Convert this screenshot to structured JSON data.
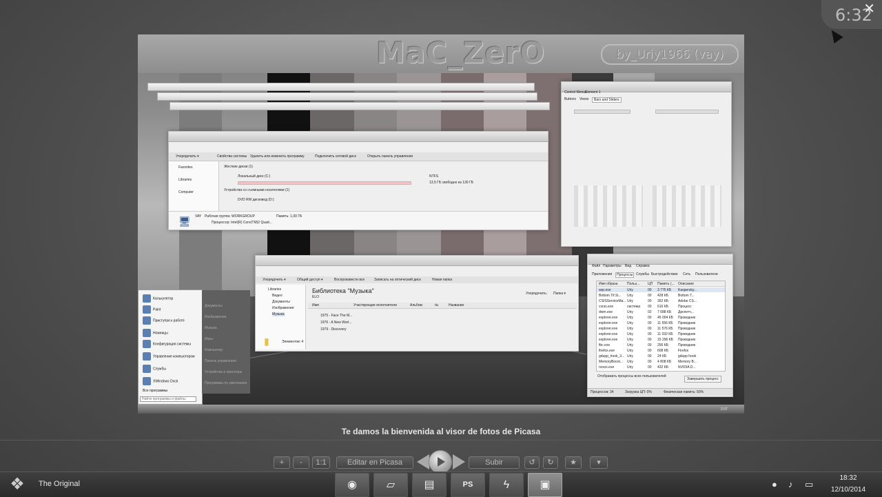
{
  "clock": {
    "time": "6:32"
  },
  "photo": {
    "banner_title": "MaC_ZerO",
    "banner_by": "by_Uriy1966  (vay)",
    "explorer": {
      "toolbar": [
        "Упорядочить ▾",
        "Свойства системы",
        "Удалить или изменить программу",
        "Подключить сетевой диск",
        "Открыть панель управления"
      ],
      "sidebar": [
        "Favorites",
        "Libraries",
        "Computer"
      ],
      "group_hdd": "Жесткие диски (1)",
      "drive_c": "Локальный диск (C:)",
      "drive_c_fs": "NTFS",
      "drive_c_free": "13,5 ГБ свободно из 130 ГБ",
      "group_removable": "Устройства со съемными носителями (1)",
      "drive_dvd": "DVD RW дисковод (D:)",
      "pc_name": "VAY",
      "workgroup": "Рабочая группа: WORKGROUP",
      "memory": "Память: 1,00 ГБ",
      "cpu": "Процессор: Intel(R) Core(TM)2 Quad..."
    },
    "music": {
      "toolbar": [
        "Упорядочить ▾",
        "Общий доступ ▾",
        "Воспроизвести все",
        "Записать на оптический диск",
        "Новая папка"
      ],
      "sidebar": [
        "Libraries",
        "Видео",
        "Документы",
        "Изображения",
        "Музыка"
      ],
      "title": "Библиотека \"Музыка\"",
      "subtitle": "ELO",
      "arrange": "Упорядочить:",
      "arrange_value": "Папка ▾",
      "columns": [
        "Имя",
        "Участвующие исполнители",
        "Альбом",
        "№",
        "Название"
      ],
      "items": [
        "1975 - Face The M...",
        "1976 - A New Worl...",
        "1979 - Discovery"
      ],
      "status": "Элементов: 4"
    },
    "control": {
      "menu": [
        "Control Menus",
        "Element 1"
      ],
      "tabs": [
        "Buttons",
        "Views",
        "Bars and Sliders"
      ]
    },
    "taskmgr": {
      "menu": [
        "Файл",
        "Параметры",
        "Вид",
        "Справка"
      ],
      "tabs": [
        "Приложения",
        "Процессы",
        "Службы",
        "Быстродействие",
        "Сеть",
        "Пользователи"
      ],
      "columns": [
        "Имя образа",
        "Польз...",
        "ЦП",
        "Память (...",
        "Описание"
      ],
      "rows": [
        [
          "avp.exe",
          "Uriy",
          "00",
          "3 776 КБ",
          "Kaspersky..."
        ],
        [
          "Bottom.Tif.Si...",
          "Uriy",
          "00",
          "428 КБ",
          "Bottom T..."
        ],
        [
          "CSISServiceMa...",
          "Uriy",
          "00",
          "352 КБ",
          "Adobe CS..."
        ],
        [
          "csrss.exe",
          "система",
          "00",
          "616 КБ",
          "Процесс"
        ],
        [
          "dwm.exe",
          "Uriy",
          "02",
          "7 688 КБ",
          "Диспетч..."
        ],
        [
          "explorer.exe",
          "Uriy",
          "00",
          "45 004 КБ",
          "Проводник"
        ],
        [
          "explorer.exe",
          "Uriy",
          "00",
          "11 556 КБ",
          "Проводник"
        ],
        [
          "explorer.exe",
          "Uriy",
          "00",
          "11 576 КБ",
          "Проводник"
        ],
        [
          "explorer.exe",
          "Uriy",
          "00",
          "11 032 КБ",
          "Проводник"
        ],
        [
          "explorer.exe",
          "Uriy",
          "00",
          "15 296 КБ",
          "Проводник"
        ],
        [
          "fbc.exe",
          "Uriy",
          "00",
          "256 КБ",
          "Проводник"
        ],
        [
          "firefox.exe",
          "Uriy",
          "00",
          "608 КБ",
          "Firefox"
        ],
        [
          "gdupp_hook_3...",
          "Uriy",
          "00",
          "24 КБ",
          "gdupp hook"
        ],
        [
          "MemoryBoost...",
          "Uriy",
          "00",
          "4 808 КБ",
          "Memory B..."
        ],
        [
          "nvxxx.exe",
          "Uriy",
          "00",
          "432 КБ",
          "NVIDIA D..."
        ]
      ],
      "show_all": "Отображать процессы всех пользователей",
      "end_button": "Завершить процесс",
      "status": [
        "Процессов: 34",
        "Загрузка ЦП: 0%",
        "Физическая память: 50%"
      ]
    },
    "start_menu": {
      "items": [
        "Калькулятор",
        "Paint",
        "Приступая к работе",
        "Ножницы",
        "Конфигурация системы",
        "Управление компьютером",
        "Службы",
        "XWindows Dock",
        "Все программы"
      ],
      "search_placeholder": "Найти программы и файлы",
      "right_items": [
        "Документы",
        "Изображения",
        "Музыка",
        "Игры",
        "Компьютер",
        "Панель управления",
        "Устройства и принтеры",
        "Программы по умолчанию"
      ]
    },
    "tray_time": "2:37"
  },
  "caption": "Te damos la bienvenida al visor de fotos de Picasa",
  "viewer_toolbar": {
    "zoom_in": "+",
    "zoom_out": "-",
    "actual_size": "1:1",
    "edit": "Editar en Picasa",
    "upload": "Subir",
    "rotate_left": "↺",
    "rotate_right": "↻",
    "star": "★",
    "more": "▾"
  },
  "taskbar": {
    "label": "The Original",
    "apps": [
      "chrome-icon",
      "tablet-icon",
      "folder-icon",
      "photoshop-icon",
      "flash-icon",
      "picasa-icon"
    ],
    "photoshop_label": "PS",
    "time": "18:32",
    "date": "12/10/2014"
  }
}
